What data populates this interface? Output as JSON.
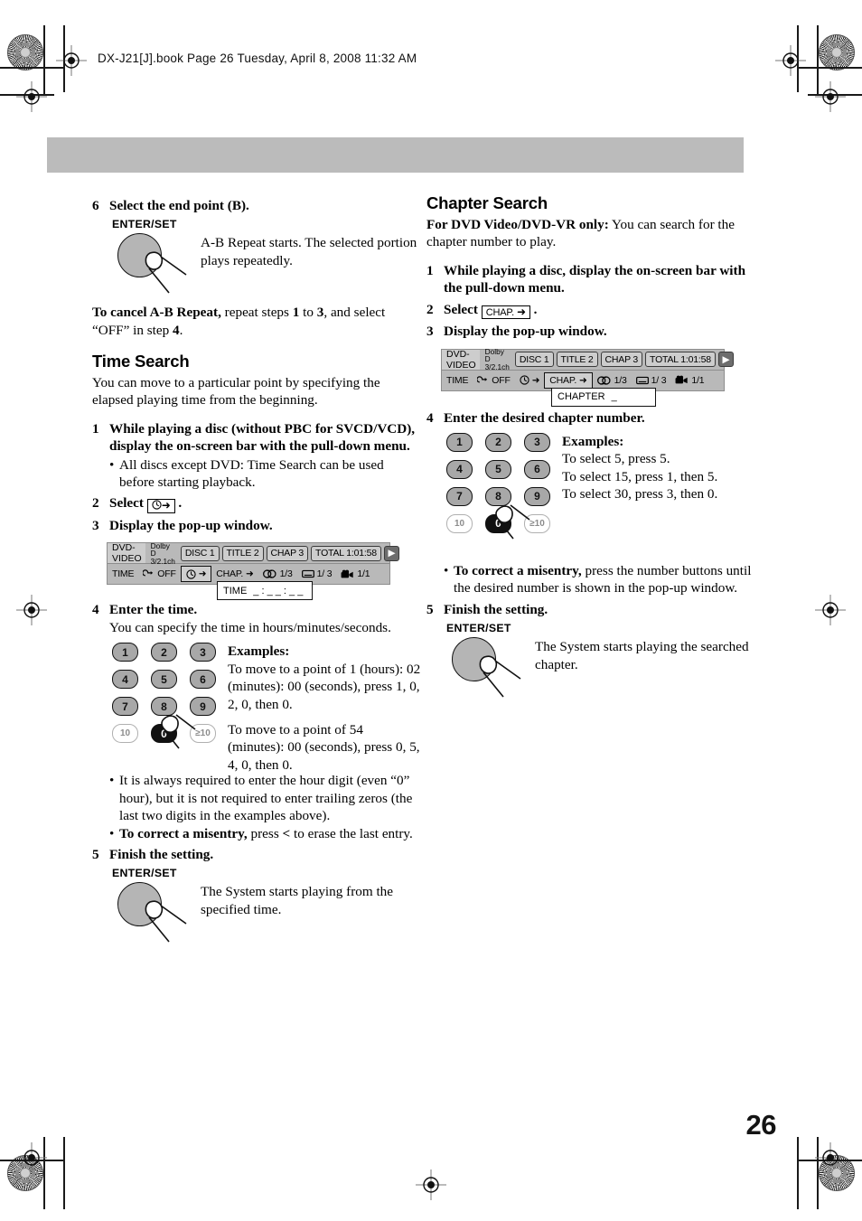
{
  "header": {
    "book_line": "DX-J21[J].book  Page 26  Tuesday, April 8, 2008  11:32 AM"
  },
  "page_number": "26",
  "left_column": {
    "step6": {
      "num": "6",
      "text": "Select the end point (B)."
    },
    "knob1": {
      "label": "ENTER/SET",
      "note": "A-B Repeat starts. The selected portion plays repeatedly."
    },
    "cancel_note": {
      "bold": "To cancel A-B Repeat,",
      "rest": " repeat steps ",
      "b1": "1",
      "mid": " to ",
      "b3": "3",
      "rest2": ", and select “OFF” in step ",
      "b4": "4",
      "end": "."
    },
    "section_title": "Time Search",
    "intro": "You can move to a particular point by specifying the elapsed playing time from the beginning.",
    "steps": [
      {
        "num": "1",
        "text": "While playing a disc (without PBC for SVCD/VCD), display the on-screen bar with the pull-down menu."
      },
      {
        "num": "2",
        "text": "Select"
      },
      {
        "num": "3",
        "text": "Display the pop-up window."
      },
      {
        "num": "4",
        "text": "Enter the time."
      },
      {
        "num": "5",
        "text": "Finish the setting."
      }
    ],
    "step1_bullet": "All discs except DVD: Time Search can be used before starting playback.",
    "step2_key": {
      "icon": "clock-icon",
      "arrow": "➜"
    },
    "step4_sub": "You can specify the time in hours/minutes/seconds.",
    "examples": {
      "heading": "Examples:",
      "line1": "To move to a point of 1 (hours): 02 (minutes): 00 (seconds), press 1, 0, 2, 0, then 0.",
      "line2": "To move to a point of 54 (minutes): 00 (seconds), press 0, 5, 4, 0, then 0."
    },
    "bullets_after": [
      "It is always required to enter the hour digit (even “0” hour), but it is not required to enter trailing zeros (the last two digits in the examples above)."
    ],
    "misentry": {
      "bold": "To correct a misentry,",
      "rest": " press ",
      "key": "<",
      "rest2": " to erase the last entry."
    },
    "knob2": {
      "label": "ENTER/SET",
      "note": "The System starts playing from the specified time."
    },
    "osd": {
      "disc_label": "DVD-VIDEO",
      "audio_format_line1": "Dolby D",
      "audio_format_line2": "3/2.1ch",
      "pills": [
        "DISC 1",
        "TITLE  2",
        "CHAP  3",
        "TOTAL   1:01:58"
      ],
      "play_arrow": "▶",
      "row2": {
        "mode": "TIME",
        "repeat_icon": "repeat-icon",
        "repeat_value": "OFF",
        "time_icon": "clock-icon",
        "time_arrow": "➜",
        "chap_label": "CHAP.",
        "chap_arrow": "➜",
        "audio_icon": "audio-icon",
        "audio_value": "1/3",
        "subtitle_icon": "subtitle-icon",
        "subtitle_value": "1/ 3",
        "angle_icon": "angle-icon",
        "angle_value": "1/1"
      },
      "popup_label": "TIME",
      "popup_value": "_ : _ _ : _ _"
    },
    "keypad": [
      "1",
      "2",
      "3",
      "4",
      "5",
      "6",
      "7",
      "8",
      "9",
      "10",
      "0",
      "≥10"
    ]
  },
  "right_column": {
    "section_title": "Chapter Search",
    "lead_bold": "For DVD Video/DVD-VR only:",
    "lead_rest": " You can search for the chapter number to play.",
    "steps": [
      {
        "num": "1",
        "text": "While playing a disc, display the on-screen bar with the pull-down menu."
      },
      {
        "num": "2",
        "text": "Select"
      },
      {
        "num": "3",
        "text": "Display the pop-up window."
      },
      {
        "num": "4",
        "text": "Enter the desired chapter number."
      },
      {
        "num": "5",
        "text": "Finish the setting."
      }
    ],
    "step2_key": {
      "label": "CHAP.",
      "arrow": "➜"
    },
    "examples": {
      "heading": "Examples:",
      "line1": "To select 5, press 5.",
      "line2": "To select 15, press 1, then 5.",
      "line3": "To select 30, press 3, then 0."
    },
    "misentry": {
      "bold": "To correct a misentry,",
      "rest": " press the number buttons until the desired number is shown in the pop-up window."
    },
    "knob": {
      "label": "ENTER/SET",
      "note": "The System starts playing the searched chapter."
    },
    "osd": {
      "disc_label": "DVD-VIDEO",
      "audio_format_line1": "Dolby D",
      "audio_format_line2": "3/2.1ch",
      "pills": [
        "DISC 1",
        "TITLE  2",
        "CHAP  3",
        "TOTAL   1:01:58"
      ],
      "play_arrow": "▶",
      "row2": {
        "mode": "TIME",
        "repeat_icon": "repeat-icon",
        "repeat_value": "OFF",
        "time_icon": "clock-icon",
        "time_arrow": "➜",
        "chap_label": "CHAP.",
        "chap_arrow": "➜",
        "audio_icon": "audio-icon",
        "audio_value": "1/3",
        "subtitle_icon": "subtitle-icon",
        "subtitle_value": "1/ 3",
        "angle_icon": "angle-icon",
        "angle_value": "1/1"
      },
      "popup_label": "CHAPTER",
      "popup_value": "_"
    },
    "keypad": [
      "1",
      "2",
      "3",
      "4",
      "5",
      "6",
      "7",
      "8",
      "9",
      "10",
      "0",
      "≥10"
    ]
  }
}
